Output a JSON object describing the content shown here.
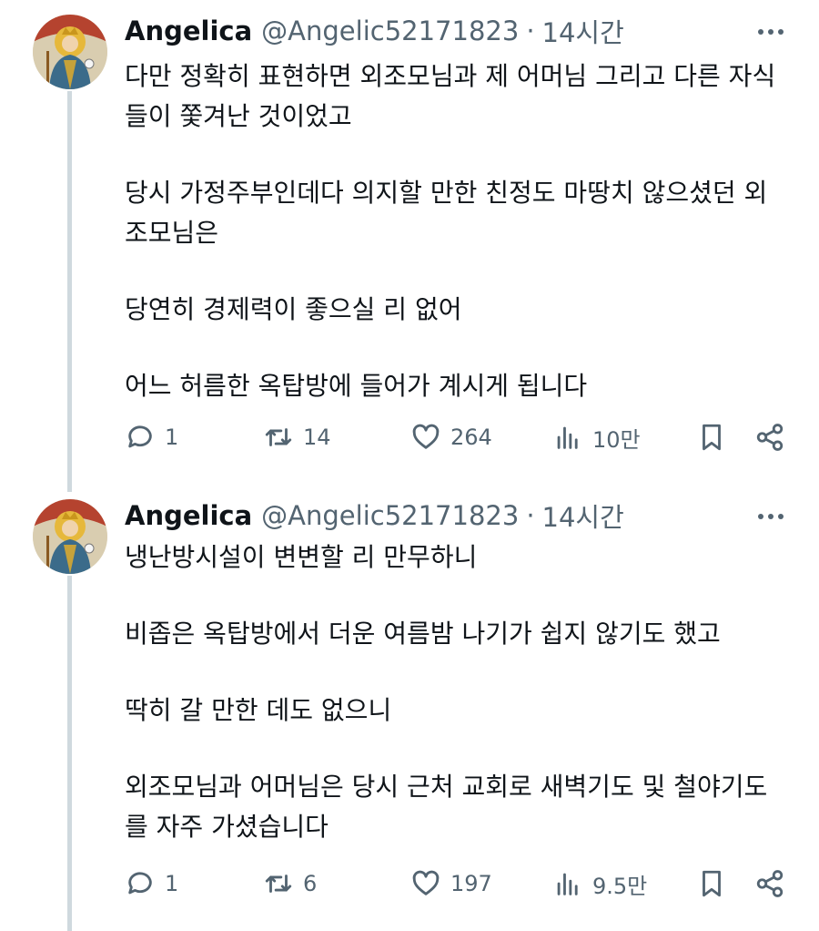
{
  "tweets": [
    {
      "author": {
        "name": "Angelica",
        "handle": "@Angelic52171823",
        "separator": "·",
        "time": "14시간",
        "avatar_icon": "saint-portrait-avatar"
      },
      "paragraphs": [
        "다만 정확히 표현하면 외조모님과 제 어머님 그리고 다른 자식들이 쫓겨난 것이었고",
        "당시 가정주부인데다 의지할 만한 친정도 마땅치 않으셨던 외조모님은",
        "당연히 경제력이 좋으실 리 없어",
        "어느 허름한 옥탑방에 들어가 계시게 됩니다"
      ],
      "stats": {
        "replies": "1",
        "retweets": "14",
        "likes": "264",
        "views": "10만"
      }
    },
    {
      "author": {
        "name": "Angelica",
        "handle": "@Angelic52171823",
        "separator": "·",
        "time": "14시간",
        "avatar_icon": "saint-portrait-avatar"
      },
      "paragraphs": [
        "냉난방시설이 변변할 리 만무하니",
        "비좁은 옥탑방에서 더운 여름밤 나기가 쉽지 않기도 했고",
        "딱히 갈 만한 데도 없으니",
        "외조모님과 어머님은 당시 근처 교회로 새벽기도 및 철야기도를 자주 가셨습니다"
      ],
      "stats": {
        "replies": "1",
        "retweets": "6",
        "likes": "197",
        "views": "9.5만"
      }
    }
  ],
  "icons": {
    "more": "more-dots-icon",
    "reply": "reply-icon",
    "retweet": "retweet-icon",
    "like": "heart-icon",
    "views": "views-chart-icon",
    "bookmark": "bookmark-icon",
    "share": "share-icon"
  },
  "colors": {
    "text": "#0f1419",
    "secondary": "#536471",
    "thread_line": "#cfd9de"
  }
}
